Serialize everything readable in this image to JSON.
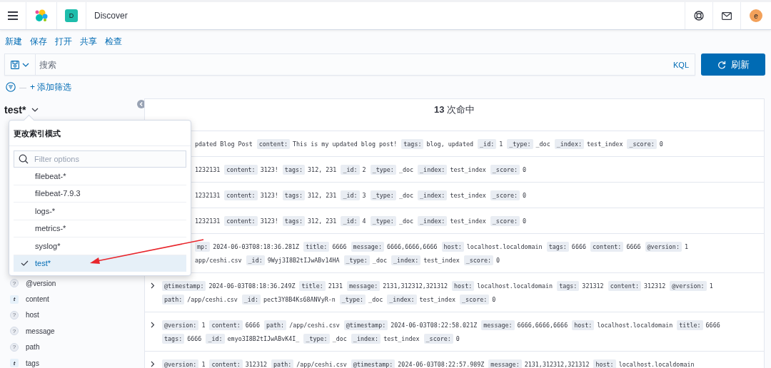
{
  "header": {
    "space_initial": "D",
    "breadcrumb": "Discover",
    "user_initial": "e"
  },
  "top_menu": [
    {
      "label": "新建"
    },
    {
      "label": "保存"
    },
    {
      "label": "打开"
    },
    {
      "label": "共享"
    },
    {
      "label": "检查"
    }
  ],
  "query_bar": {
    "placeholder": "搜索",
    "language": "KQL",
    "refresh_button": "刷新"
  },
  "filter_bar": {
    "separator": "—",
    "add_filter": "+ 添加筛选"
  },
  "index_pattern": {
    "title": "test*"
  },
  "index_popover": {
    "title": "更改索引模式",
    "filter_placeholder": "Filter options",
    "options": [
      {
        "label": "filebeat-*",
        "selected": false
      },
      {
        "label": "filebeat-7.9.3",
        "selected": false
      },
      {
        "label": "logs-*",
        "selected": false
      },
      {
        "label": "metrics-*",
        "selected": false
      },
      {
        "label": "syslog*",
        "selected": false
      },
      {
        "label": "test*",
        "selected": true
      }
    ]
  },
  "fields": [
    {
      "name": "@version",
      "kind": "unknown",
      "type_glyph": "?"
    },
    {
      "name": "content",
      "kind": "string",
      "type_glyph": "t"
    },
    {
      "name": "host",
      "kind": "unknown",
      "type_glyph": "?"
    },
    {
      "name": "message",
      "kind": "unknown",
      "type_glyph": "?"
    },
    {
      "name": "path",
      "kind": "unknown",
      "type_glyph": "?"
    },
    {
      "name": "tags",
      "kind": "string",
      "type_glyph": "t"
    }
  ],
  "results": {
    "hits": "**13** 次命中",
    "rows": [
      {
        "kind": "covered",
        "lines": [
          [
            {
              "value": "pdated Blog Post"
            },
            {
              "key": "content:",
              "value": "This is my updated blog post!"
            },
            {
              "key": "tags:",
              "value": "blog, updated"
            },
            {
              "key": "_id:",
              "value": "1"
            },
            {
              "key": "_type:",
              "value": "_doc"
            },
            {
              "key": "_index:",
              "value": "test_index"
            },
            {
              "key": "_score:",
              "value": "0"
            }
          ]
        ]
      },
      {
        "kind": "covered",
        "lines": [
          [
            {
              "value": "1232131"
            },
            {
              "key": "content:",
              "value": "3123!"
            },
            {
              "key": "tags:",
              "value": "312, 231"
            },
            {
              "key": "_id:",
              "value": "2"
            },
            {
              "key": "_type:",
              "value": "_doc"
            },
            {
              "key": "_index:",
              "value": "test_index"
            },
            {
              "key": "_score:",
              "value": "0"
            }
          ]
        ]
      },
      {
        "kind": "covered",
        "lines": [
          [
            {
              "value": "1232131"
            },
            {
              "key": "content:",
              "value": "3123!"
            },
            {
              "key": "tags:",
              "value": "312, 231"
            },
            {
              "key": "_id:",
              "value": "3"
            },
            {
              "key": "_type:",
              "value": "_doc"
            },
            {
              "key": "_index:",
              "value": "test_index"
            },
            {
              "key": "_score:",
              "value": "0"
            }
          ]
        ]
      },
      {
        "kind": "covered",
        "lines": [
          [
            {
              "value": "1232131"
            },
            {
              "key": "content:",
              "value": "3123!"
            },
            {
              "key": "tags:",
              "value": "312, 231"
            },
            {
              "key": "_id:",
              "value": "4"
            },
            {
              "key": "_type:",
              "value": "_doc"
            },
            {
              "key": "_index:",
              "value": "test_index"
            },
            {
              "key": "_score:",
              "value": "0"
            }
          ]
        ]
      },
      {
        "kind": "covered",
        "lines": [
          [
            {
              "key": "mp:",
              "value": "2024-06-03T08:18:36.281Z"
            },
            {
              "key": "title:",
              "value": "6666"
            },
            {
              "key": "message:",
              "value": "6666,6666,6666"
            },
            {
              "key": "host:",
              "value": "localhost.localdomain"
            },
            {
              "key": "tags:",
              "value": "6666"
            },
            {
              "key": "content:",
              "value": "6666"
            },
            {
              "key": "@version:",
              "value": "1"
            }
          ],
          [
            {
              "value": "app/ceshi.csv"
            },
            {
              "key": "_id:",
              "value": "9Wyj3I8B2tIJwABv14HA"
            },
            {
              "key": "_type:",
              "value": "_doc"
            },
            {
              "key": "_index:",
              "value": "test_index"
            },
            {
              "key": "_score:",
              "value": "0"
            }
          ]
        ]
      },
      {
        "kind": "full",
        "lines": [
          [
            {
              "key": "@timestamp:",
              "value": "2024-06-03T08:18:36.249Z"
            },
            {
              "key": "title:",
              "value": "2131"
            },
            {
              "key": "message:",
              "value": "2131,312312,321312"
            },
            {
              "key": "host:",
              "value": "localhost.localdomain"
            },
            {
              "key": "tags:",
              "value": "321312"
            },
            {
              "key": "content:",
              "value": "312312"
            },
            {
              "key": "@version:",
              "value": "1"
            }
          ],
          [
            {
              "key": "path:",
              "value": "/app/ceshi.csv"
            },
            {
              "key": "_id:",
              "value": "pect3Y8B4Ks68ANVyR-n"
            },
            {
              "key": "_type:",
              "value": "_doc"
            },
            {
              "key": "_index:",
              "value": "test_index"
            },
            {
              "key": "_score:",
              "value": "0"
            }
          ]
        ]
      },
      {
        "kind": "full",
        "lines": [
          [
            {
              "key": "@version:",
              "value": "1"
            },
            {
              "key": "content:",
              "value": "6666"
            },
            {
              "key": "path:",
              "value": "/app/ceshi.csv"
            },
            {
              "key": "@timestamp:",
              "value": "2024-06-03T08:22:58.021Z"
            },
            {
              "key": "message:",
              "value": "6666,6666,6666"
            },
            {
              "key": "host:",
              "value": "localhost.localdomain"
            },
            {
              "key": "title:",
              "value": "6666"
            }
          ],
          [
            {
              "key": "tags:",
              "value": "6666"
            },
            {
              "key": "_id:",
              "value": "emyo3I8B2tIJwABvK4I_"
            },
            {
              "key": "_type:",
              "value": "_doc"
            },
            {
              "key": "_index:",
              "value": "test_index"
            },
            {
              "key": "_score:",
              "value": "0"
            }
          ]
        ]
      },
      {
        "kind": "full",
        "lines": [
          [
            {
              "key": "@version:",
              "value": "1"
            },
            {
              "key": "content:",
              "value": "312312"
            },
            {
              "key": "path:",
              "value": "/app/ceshi.csv"
            },
            {
              "key": "@timestamp:",
              "value": "2024-06-03T08:22:57.989Z"
            },
            {
              "key": "message:",
              "value": "2131,312312,321312"
            },
            {
              "key": "host:",
              "value": "localhost.localdomain"
            }
          ]
        ]
      }
    ]
  }
}
